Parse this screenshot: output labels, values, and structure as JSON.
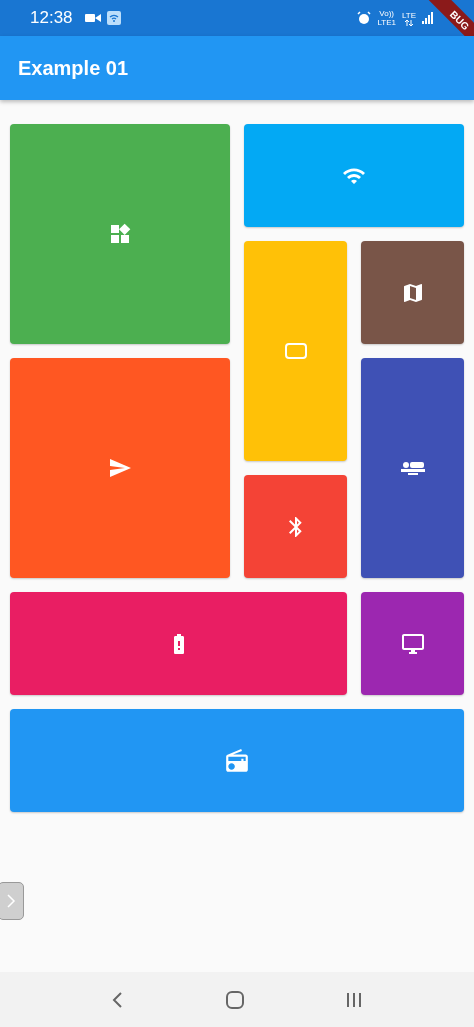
{
  "status_bar": {
    "time": "12:38",
    "volte": "Vo))",
    "lte1": "LTE1",
    "lte": "LTE"
  },
  "debug_banner": "BUG",
  "app_bar": {
    "title": "Example 01"
  },
  "tiles": [
    {
      "kind": "widgets",
      "color": "#4caf50"
    },
    {
      "kind": "wifi",
      "color": "#03a9f4"
    },
    {
      "kind": "panorama",
      "color": "#ffc107"
    },
    {
      "kind": "map",
      "color": "#795548"
    },
    {
      "kind": "send",
      "color": "#ff5722"
    },
    {
      "kind": "bed",
      "color": "#3f51b5"
    },
    {
      "kind": "bluetooth",
      "color": "#f44336"
    },
    {
      "kind": "battery",
      "color": "#e91e63"
    },
    {
      "kind": "desktop",
      "color": "#9c27b0"
    },
    {
      "kind": "radio",
      "color": "#2196f3"
    }
  ]
}
